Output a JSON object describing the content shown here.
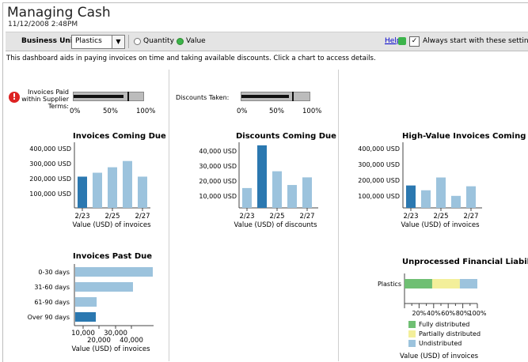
{
  "header": {
    "title": "Managing Cash",
    "timestamp": "11/12/2008 2:48PM"
  },
  "toolbar": {
    "business_unit_label": "Business Unit",
    "business_unit_value": "Plastics",
    "dropdown_arrow": "▼",
    "radio_quantity": "Quantity",
    "radio_value": "Value",
    "selected": "Value",
    "help": "Help",
    "always_start": "Always start with these settings",
    "checkbox_mark": "✓"
  },
  "intro": "This dashboard aids in paying invoices on time and taking available discounts. Click a chart to access details.",
  "gauges": {
    "invoices_paid": {
      "label_lines": [
        "Invoices Paid",
        "within Supplier",
        "Terms:"
      ],
      "fill": 0.72,
      "target": 0.77,
      "ticks": [
        "0%",
        "50%",
        "100%"
      ]
    },
    "discounts_taken": {
      "label": "Discounts Taken:",
      "fill": 0.7,
      "target": 0.74,
      "ticks": [
        "0%",
        "50%",
        "100%"
      ]
    },
    "alert_icon": "!"
  },
  "colors": {
    "dark_bar": "#2b78b0",
    "light_bar": "#9cc3dd",
    "green": "#6fbf73",
    "yellow": "#f3ef9a",
    "blue": "#9cc3dd",
    "axis": "#444"
  },
  "chart_data": [
    {
      "id": "invoices_coming_due",
      "type": "bar",
      "title": "Invoices Coming Due",
      "xlabel": "Value (USD) of invoices",
      "ylabel": "",
      "categories": [
        "2/23",
        "2/24",
        "2/25",
        "2/26",
        "2/27"
      ],
      "x_tick_labels": [
        "2/23",
        "2/25",
        "2/27"
      ],
      "values": [
        200000,
        225000,
        260000,
        300000,
        200000
      ],
      "y_ticks": [
        "400,000 USD",
        "300,000 USD",
        "200,000 USD",
        "100,000 USD"
      ],
      "ylim": [
        0,
        420000
      ],
      "highlight_index": 0
    },
    {
      "id": "discounts_coming_due",
      "type": "bar",
      "title": "Discounts Coming Due",
      "xlabel": "Value (USD) of discounts",
      "ylabel": "",
      "categories": [
        "2/23",
        "2/24",
        "2/25",
        "2/26",
        "2/27"
      ],
      "x_tick_labels": [
        "2/23",
        "2/25",
        "2/27"
      ],
      "values": [
        13000,
        41000,
        24000,
        15000,
        20000
      ],
      "y_ticks": [
        "40,000 USD",
        "30,000 USD",
        "20,000 USD",
        "10,000 USD"
      ],
      "ylim": [
        0,
        43000
      ],
      "highlight_index": 1
    },
    {
      "id": "high_value_invoices_coming_due",
      "type": "bar",
      "title": "High-Value Invoices Coming Due",
      "xlabel": "Value (USD) of invoices",
      "ylabel": "",
      "categories": [
        "2/23",
        "2/24",
        "2/25",
        "2/26",
        "2/27"
      ],
      "x_tick_labels": [
        "2/23",
        "2/25",
        "2/27"
      ],
      "values": [
        140000,
        110000,
        190000,
        75000,
        135000
      ],
      "y_ticks": [
        "400,000 USD",
        "300,000 USD",
        "200,000 USD",
        "100,000 USD"
      ],
      "ylim": [
        0,
        410000
      ],
      "highlight_index": 0
    },
    {
      "id": "invoices_past_due",
      "type": "bar",
      "orientation": "horizontal",
      "title": "Invoices Past Due",
      "xlabel": "Value (USD) of invoices",
      "ylabel": "",
      "categories": [
        "0-30 days",
        "31-60 days",
        "61-90 days",
        "Over 90 days"
      ],
      "values": [
        47000,
        35000,
        13000,
        12500
      ],
      "x_tick_labels_top": [
        "10,000",
        "30,000"
      ],
      "x_tick_labels_bottom": [
        "20,000",
        "40,000"
      ],
      "xlim": [
        0,
        47000
      ],
      "highlight_index": 3
    },
    {
      "id": "unprocessed_financial_liability",
      "type": "bar",
      "orientation": "horizontal-stacked",
      "title": "Unprocessed Financial Liability",
      "xlabel": "Value (USD) of invoices",
      "ylabel": "",
      "categories": [
        "Plastics"
      ],
      "series": [
        {
          "name": "Fully distributed",
          "values": [
            0.38
          ]
        },
        {
          "name": "Partially distributed",
          "values": [
            0.38
          ]
        },
        {
          "name": "Undistributed",
          "values": [
            0.24
          ]
        }
      ],
      "x_tick_labels": [
        "20%",
        "40%",
        "60%",
        "80%",
        "100%"
      ],
      "xlim": [
        0,
        1
      ]
    }
  ]
}
